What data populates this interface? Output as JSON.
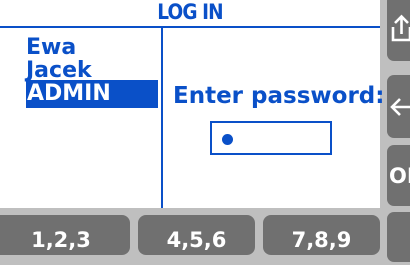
{
  "header": {
    "title": "LOG IN"
  },
  "users": [
    {
      "label": "Ewa",
      "selected": false
    },
    {
      "label": "Jacek",
      "selected": false
    },
    {
      "label": "ADMIN",
      "selected": true
    }
  ],
  "password_prompt": "Enter password:",
  "password_field": {
    "masked_char_count": 1
  },
  "side_buttons": {
    "export_icon": "export-icon",
    "back_icon": "back-arrow-icon",
    "ok_label": "OK",
    "extra_icon": ""
  },
  "keypad_buttons": [
    "1,2,3",
    "4,5,6",
    "7,8,9"
  ],
  "colors": {
    "accent": "#0a50c8",
    "button": "#707070",
    "frame": "#bfbfbf"
  }
}
